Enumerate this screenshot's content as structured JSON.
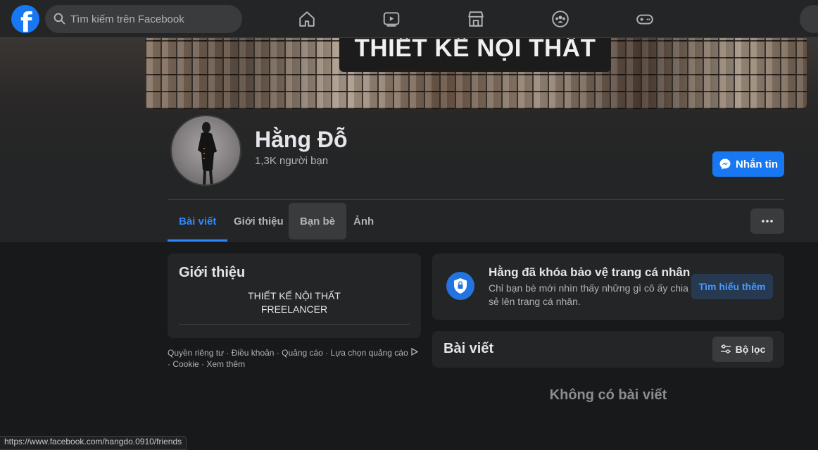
{
  "nav": {
    "logo_letter": "f",
    "search_placeholder": "Tìm kiếm trên Facebook",
    "icons": [
      "home-icon",
      "watch-icon",
      "marketplace-icon",
      "groups-icon",
      "gaming-icon"
    ]
  },
  "cover": {
    "banner_text": "THIẾT KẾ NỘI THẤT"
  },
  "profile": {
    "name": "Hằng Đỗ",
    "friends": "1,3K người bạn",
    "message_button": "Nhắn tin"
  },
  "tabs": [
    {
      "label": "Bài viết",
      "active": true
    },
    {
      "label": "Giới thiệu",
      "active": false
    },
    {
      "label": "Bạn bè",
      "active": false
    },
    {
      "label": "Ảnh",
      "active": false
    }
  ],
  "intro": {
    "title": "Giới thiệu",
    "bio_line1": "THIẾT KẾ NỘI THẤT",
    "bio_line2": "FREELANCER"
  },
  "footer": {
    "privacy": "Quyền riêng tư",
    "terms": "Điều khoản",
    "ads": "Quảng cáo",
    "ad_choices": "Lựa chọn quảng cáo",
    "cookie": "Cookie",
    "more": "Xem thêm",
    "separator": " · "
  },
  "locked": {
    "title": "Hằng đã khóa bảo vệ trang cá nhân",
    "description": "Chỉ bạn bè mới nhìn thấy những gì cô ấy chia sẻ lên trang cá nhân.",
    "learn_more": "Tìm hiểu thêm"
  },
  "posts": {
    "title": "Bài viết",
    "filter_button": "Bộ lọc",
    "empty_text": "Không có bài viết"
  },
  "status_url": "https://www.facebook.com/hangdo.0910/friends",
  "colors": {
    "accent": "#1877f2",
    "tab_active": "#2d88ff",
    "background": "#18191a",
    "card": "#242526"
  }
}
